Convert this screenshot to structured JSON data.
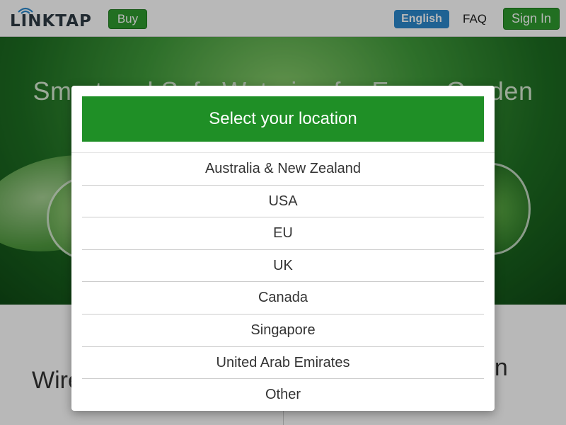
{
  "header": {
    "logo_text": "LINKTAP",
    "buy_label": "Buy",
    "language_label": "English",
    "faq_label": "FAQ",
    "signin_label": "Sign In"
  },
  "hero": {
    "title": "Smart and Safe Watering for Every Garden"
  },
  "features": {
    "left_text": "Wire",
    "right_text": "on"
  },
  "modal": {
    "title": "Select your location",
    "locations": [
      "Australia & New Zealand",
      "USA",
      "EU",
      "UK",
      "Canada",
      "Singapore",
      "United Arab Emirates",
      "Other"
    ]
  },
  "colors": {
    "brand_green": "#1f8f26",
    "language_blue": "#2b88cc",
    "logo_dark": "#2f3b45"
  }
}
